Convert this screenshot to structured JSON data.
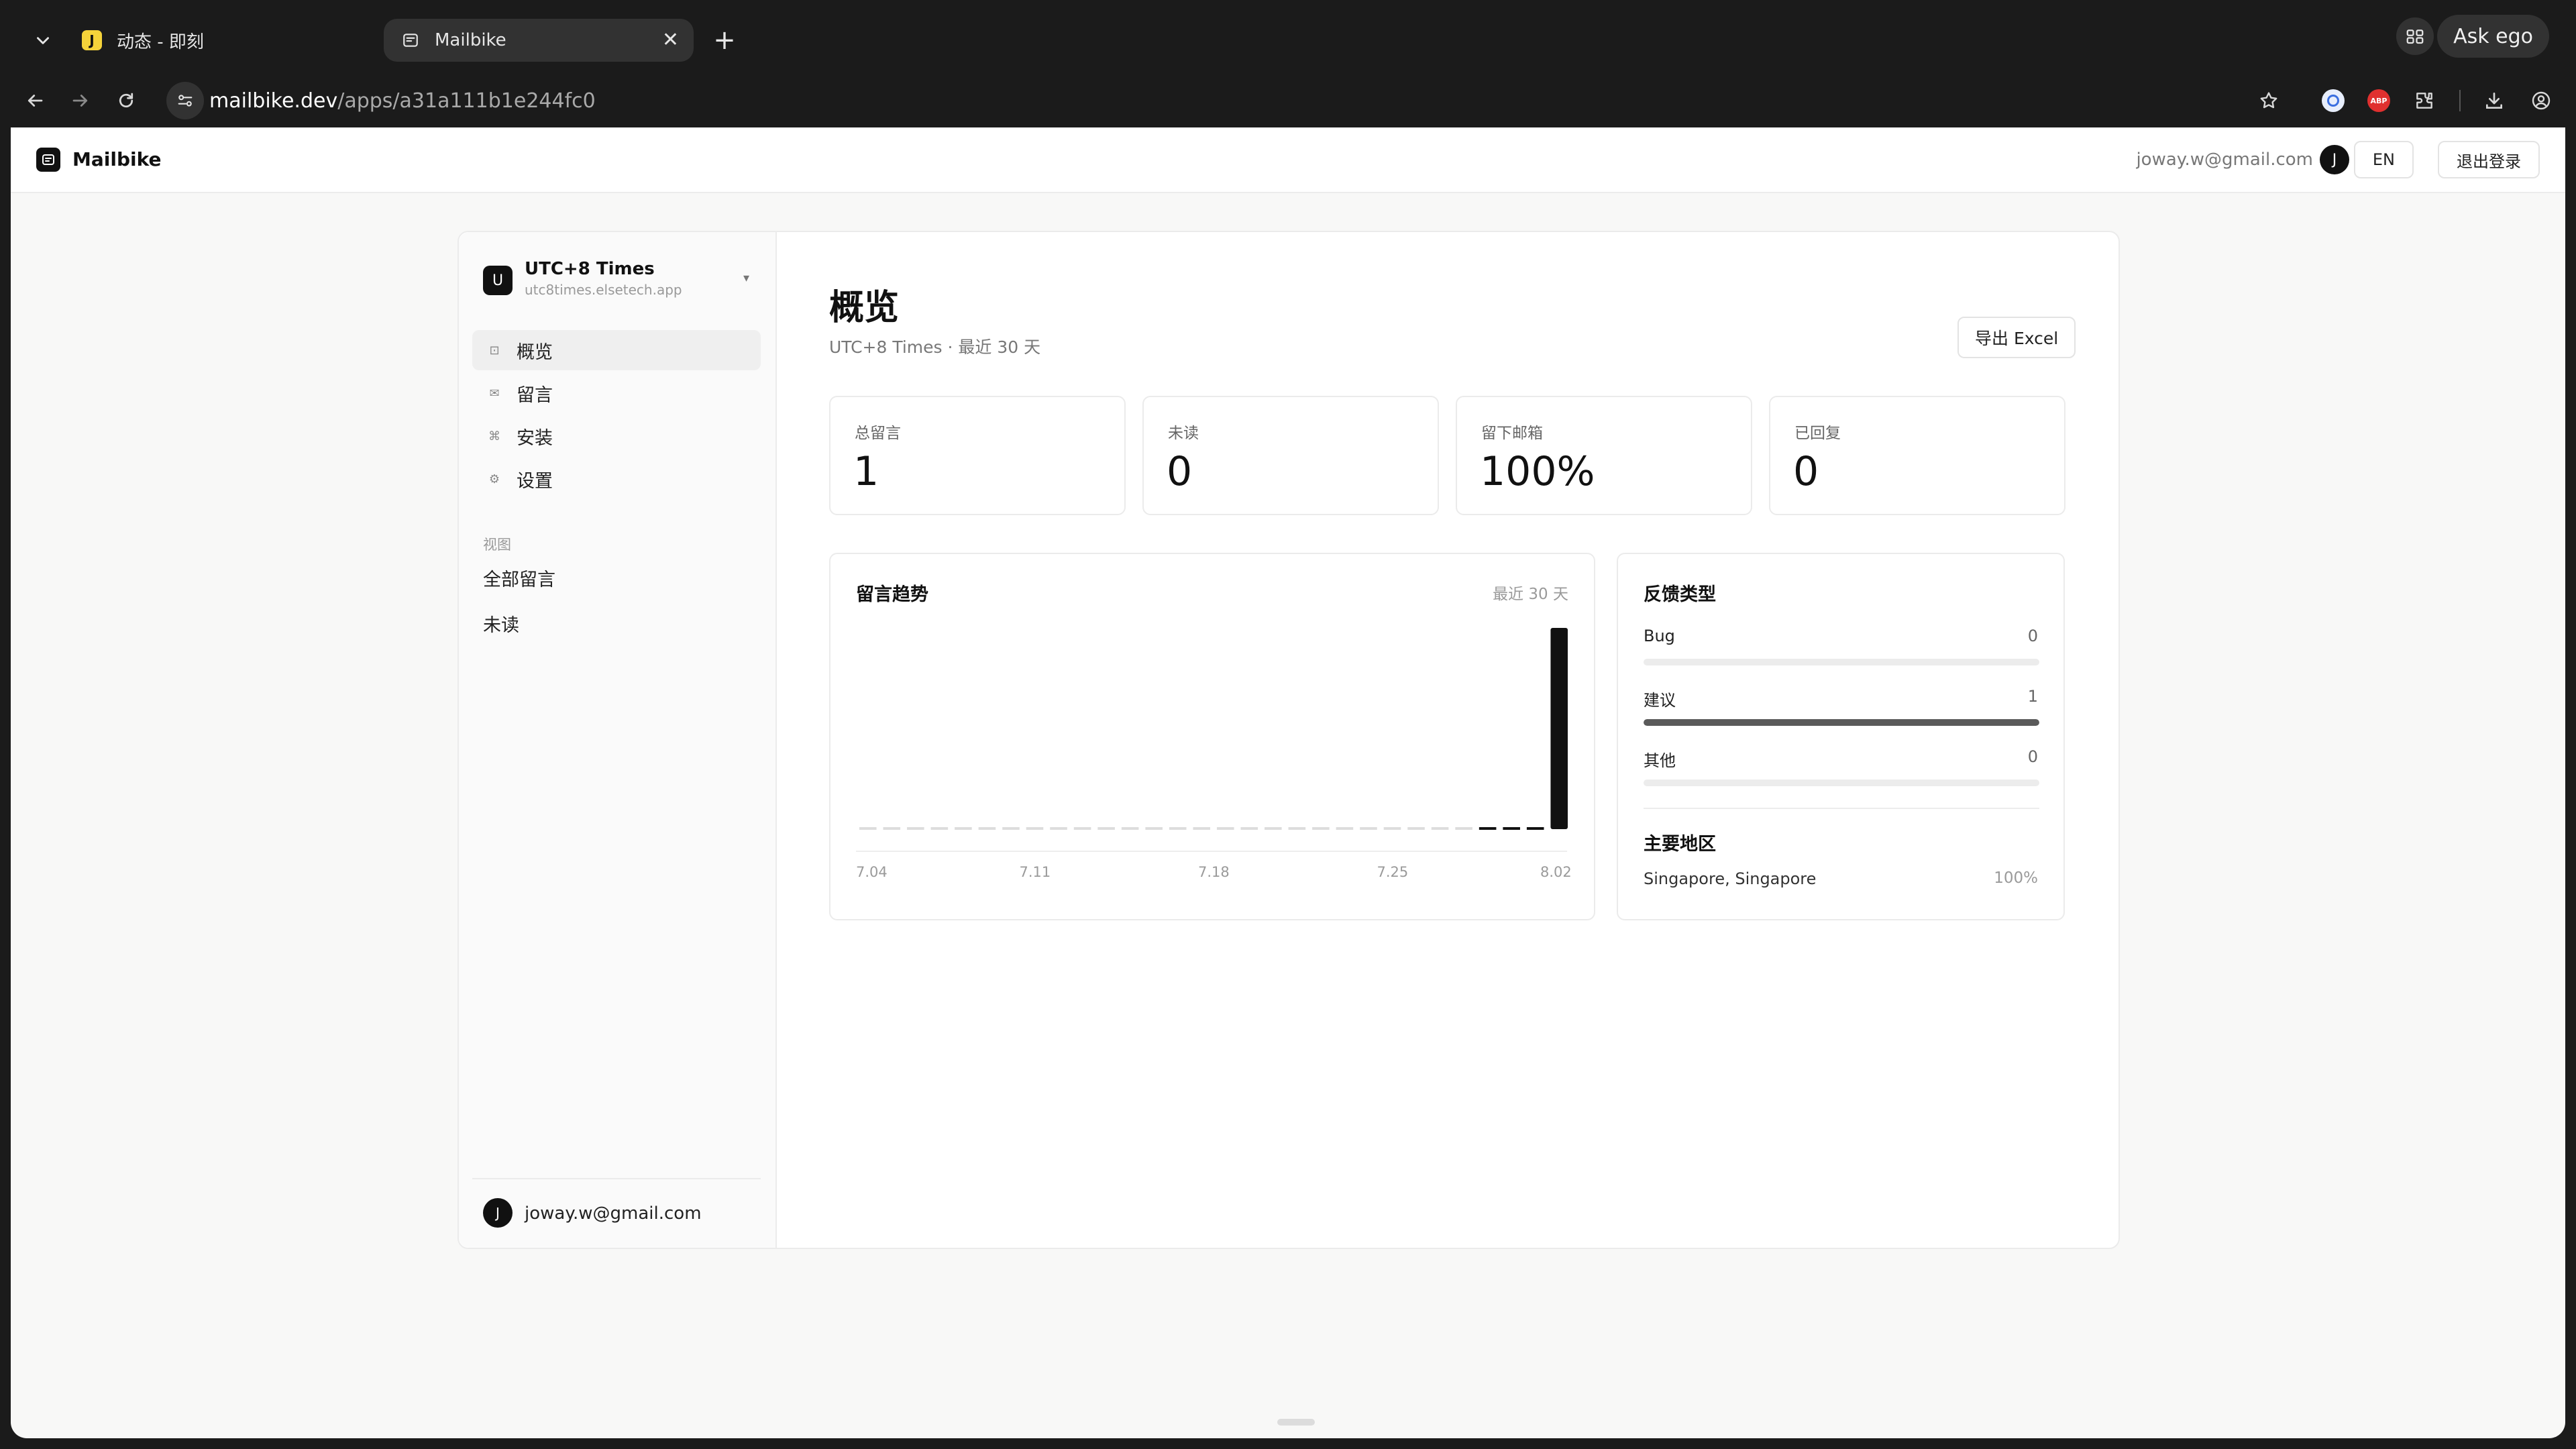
{
  "browser": {
    "tabs": [
      {
        "title": "动态 - 即刻",
        "favicon_text": "J",
        "active": false
      },
      {
        "title": "Mailbike",
        "active": true
      }
    ],
    "ask_ego_label": "Ask ego",
    "url": {
      "host": "mailbike.dev",
      "path": "/apps/a31a111b1e244fc0"
    },
    "ext_abp_label": "ABP"
  },
  "header": {
    "brand": "Mailbike",
    "email": "joway.w@gmail.com",
    "avatar_initial": "J",
    "lang_button": "EN",
    "logout_button": "退出登录"
  },
  "sidebar": {
    "app": {
      "initial": "U",
      "name": "UTC+8 Times",
      "domain": "utc8times.elsetech.app"
    },
    "nav": [
      {
        "label": "概览",
        "icon": "grid-icon",
        "active": true
      },
      {
        "label": "留言",
        "icon": "mail-icon",
        "active": false
      },
      {
        "label": "安装",
        "icon": "command-icon",
        "active": false
      },
      {
        "label": "设置",
        "icon": "gear-icon",
        "active": false
      }
    ],
    "views_label": "视图",
    "views": [
      "全部留言",
      "未读"
    ],
    "footer": {
      "avatar_initial": "J",
      "email": "joway.w@gmail.com"
    }
  },
  "main": {
    "title": "概览",
    "subtitle": "UTC+8 Times · 最近 30 天",
    "export_button": "导出 Excel",
    "stats": [
      {
        "label": "总留言",
        "value": "1"
      },
      {
        "label": "未读",
        "value": "0"
      },
      {
        "label": "留下邮箱",
        "value": "100%"
      },
      {
        "label": "已回复",
        "value": "0"
      }
    ],
    "trend": {
      "title": "留言趋势",
      "range_label": "最近 30 天"
    },
    "feedback": {
      "title": "反馈类型",
      "rows": [
        {
          "label": "Bug",
          "value": 0,
          "share": 0
        },
        {
          "label": "建议",
          "value": 1,
          "share": 1
        },
        {
          "label": "其他",
          "value": 0,
          "share": 0
        }
      ],
      "region_title": "主要地区",
      "region_name": "Singapore, Singapore",
      "region_pct": "100%"
    }
  },
  "colors": {
    "accent": "#111111",
    "bar": "#111111",
    "bar_empty": "#dddddd",
    "feedback_fill": "#5a5a5a"
  },
  "chart_data": {
    "type": "bar",
    "title": "留言趋势",
    "x_tick_labels": [
      "7.04",
      "7.11",
      "7.18",
      "7.25",
      "8.02"
    ],
    "categories": [
      "7.04",
      "7.05",
      "7.06",
      "7.07",
      "7.08",
      "7.09",
      "7.10",
      "7.11",
      "7.12",
      "7.13",
      "7.14",
      "7.15",
      "7.16",
      "7.17",
      "7.18",
      "7.19",
      "7.20",
      "7.21",
      "7.22",
      "7.23",
      "7.24",
      "7.25",
      "7.26",
      "7.27",
      "7.28",
      "7.29",
      "7.30",
      "7.31",
      "8.01",
      "8.02"
    ],
    "values": [
      0,
      0,
      0,
      0,
      0,
      0,
      0,
      0,
      0,
      0,
      0,
      0,
      0,
      0,
      0,
      0,
      0,
      0,
      0,
      0,
      0,
      0,
      0,
      0,
      0,
      0,
      0,
      0,
      0,
      1
    ],
    "ylim": [
      0,
      1
    ],
    "grid": false,
    "legend": "none"
  }
}
